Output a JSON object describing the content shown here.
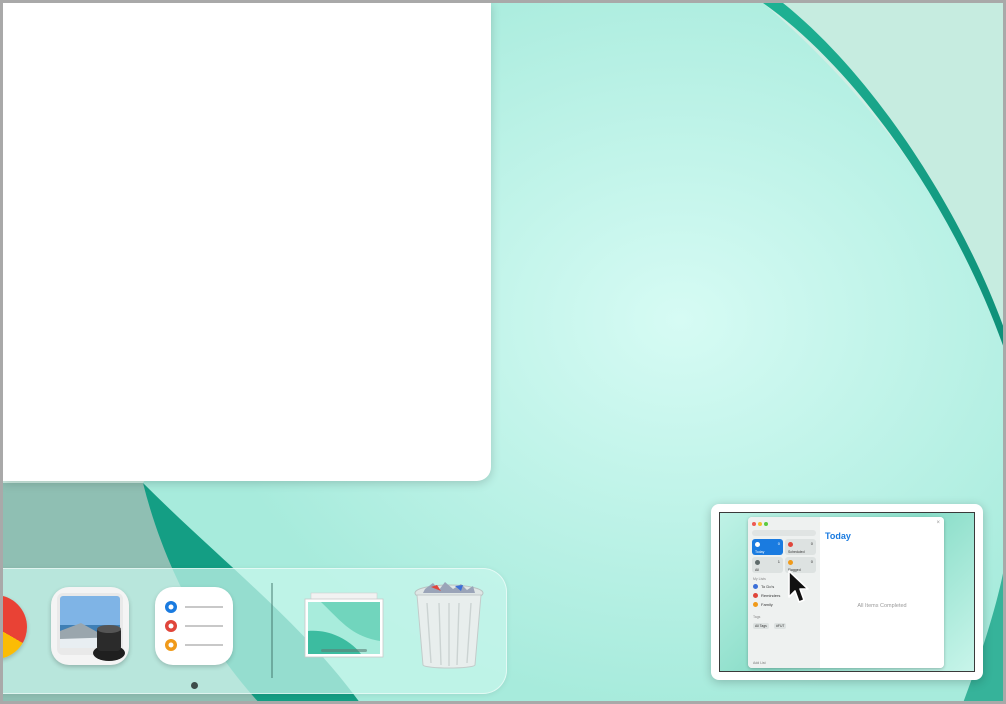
{
  "dock": {
    "items": [
      {
        "name": "Chrome"
      },
      {
        "name": "Preview"
      },
      {
        "name": "Reminders"
      },
      {
        "name": "Desktop"
      },
      {
        "name": "Trash"
      }
    ]
  },
  "thumbnail": {
    "app_title": "Today",
    "empty_text": "All Items Completed",
    "smart_lists": [
      {
        "label": "Today",
        "count": "0",
        "color": "#1a7be0"
      },
      {
        "label": "Scheduled",
        "count": "0",
        "color": "#e0463b"
      },
      {
        "label": "All",
        "count": "1",
        "color": "#5e6a6a"
      },
      {
        "label": "Flagged",
        "count": "0",
        "color": "#f09a1a"
      }
    ],
    "lists_header": "My Lists",
    "lists": [
      {
        "label": "To Do's",
        "color": "#3b6fd8"
      },
      {
        "label": "Reminders",
        "color": "#e0463b"
      },
      {
        "label": "Family",
        "color": "#f09a1a"
      }
    ],
    "tags_header": "Tags",
    "tags": [
      "All Tags",
      "#FUT"
    ],
    "add_list": "Add List"
  }
}
